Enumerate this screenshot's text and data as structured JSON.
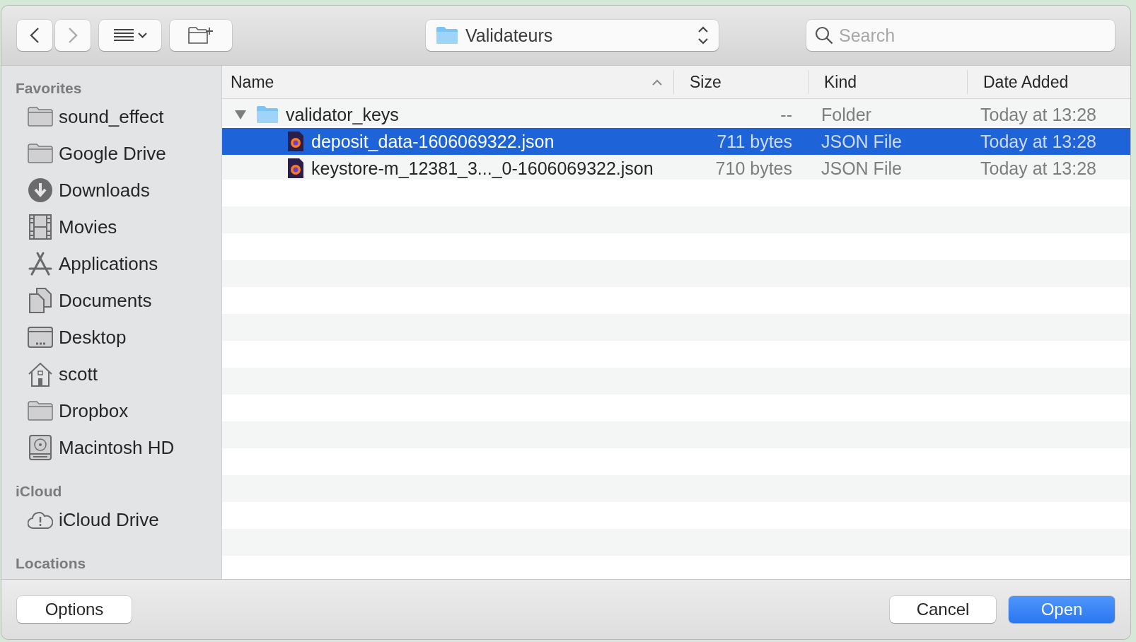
{
  "toolbar": {
    "back": {
      "disabled": false
    },
    "forward": {
      "disabled": true
    },
    "location": "Validateurs",
    "search": {
      "placeholder": "Search"
    }
  },
  "sidebar": {
    "sections": [
      {
        "title": "Favorites",
        "items": [
          {
            "label": "sound_effect",
            "kind": "folder"
          },
          {
            "label": "Google Drive",
            "kind": "folder"
          },
          {
            "label": "Downloads",
            "kind": "download"
          },
          {
            "label": "Movies",
            "kind": "film"
          },
          {
            "label": "Applications",
            "kind": "apps"
          },
          {
            "label": "Documents",
            "kind": "document"
          },
          {
            "label": "Desktop",
            "kind": "desktop"
          },
          {
            "label": "scott",
            "kind": "home"
          },
          {
            "label": "Dropbox",
            "kind": "folder"
          },
          {
            "label": "Macintosh HD",
            "kind": "disk"
          }
        ]
      },
      {
        "title": "iCloud",
        "items": [
          {
            "label": "iCloud Drive",
            "kind": "cloud"
          }
        ]
      },
      {
        "title": "Locations"
      }
    ]
  },
  "table": {
    "columns": [
      {
        "label": "Name",
        "sorted": true
      },
      {
        "label": "Size",
        "sorted": false
      },
      {
        "label": "Kind",
        "sorted": false
      },
      {
        "label": "Date Added",
        "sorted": false
      }
    ],
    "rows": [
      {
        "name": "validator_keys",
        "kind": "folder",
        "size": "--",
        "type": "Folder",
        "date": "Today at 13:28",
        "selected": false,
        "expanded": true,
        "children": [
          {
            "name": "deposit_data-1606069322.json",
            "kind": "file",
            "size": "711 bytes",
            "type": "JSON File",
            "date": "Today at 13:28",
            "selected": true
          },
          {
            "name": "keystore-m_12381_3..._0-1606069322.json",
            "kind": "file",
            "size": "710 bytes",
            "type": "JSON File",
            "date": "Today at 13:28",
            "selected": false
          }
        ]
      }
    ]
  },
  "buttons": {
    "options": "Options",
    "cancel": "Cancel",
    "open": "Open"
  }
}
